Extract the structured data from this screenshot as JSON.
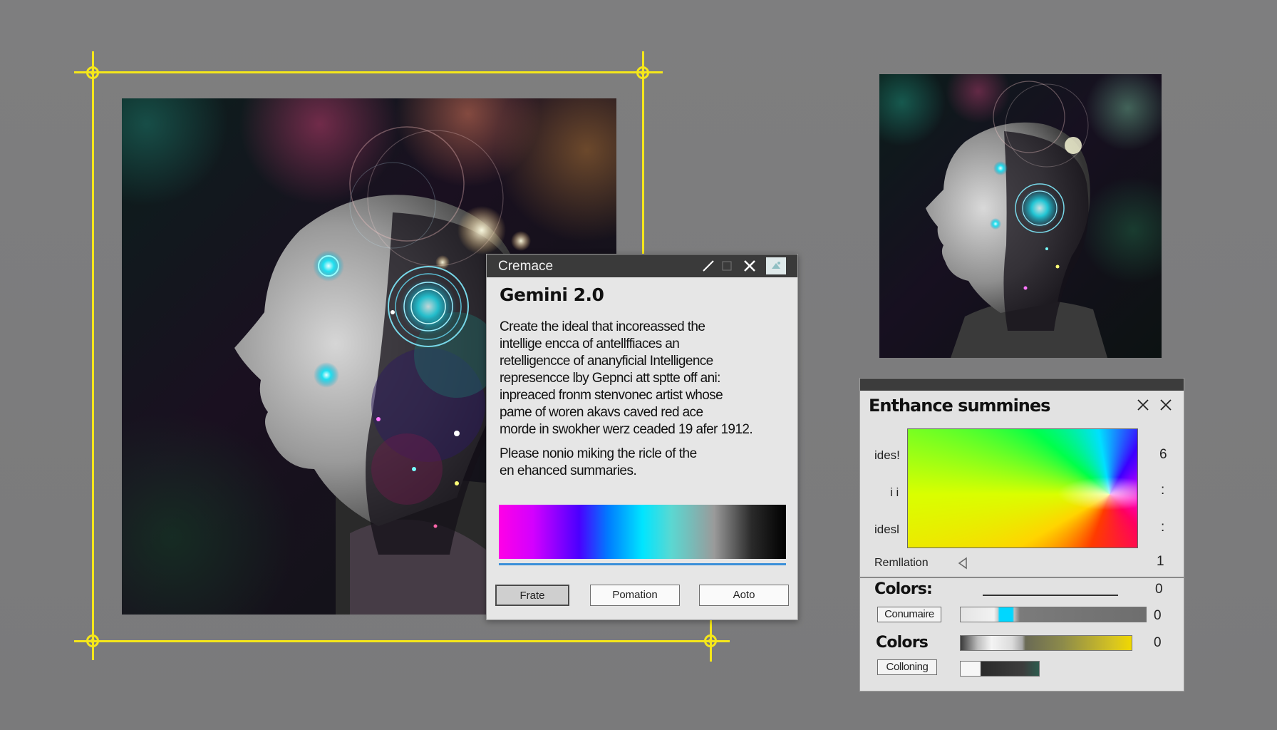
{
  "dialog": {
    "title": "Cremace",
    "heading": "Gemini 2.0",
    "body_lines": [
      "Create the ideal that incoreassed the",
      "intellige encca of antellffiaces an",
      "retelligencce of ananyficial Intelligence",
      "represencce lby Gepnci att sptte  off ani:",
      "inpreaced fronm stenvonec artist whose",
      "pame of woren akavs caved red ace",
      "morde in swokher werz ceaded 19 afer 1912."
    ],
    "prompt_lines": [
      "Please nonio miking the ricle of the",
      "en ehanced summaries."
    ],
    "buttons": {
      "primary": "Frate",
      "secondary": "Pomation",
      "tertiary": "Aoto"
    }
  },
  "panel": {
    "title": "Enthance summines",
    "rows": [
      {
        "label": "ides!",
        "value": "6"
      },
      {
        "label": "i i",
        "value": ":"
      },
      {
        "label": "idesl",
        "value": ":"
      }
    ],
    "remlation": {
      "label": "Remllation",
      "value": "1"
    },
    "colors1": {
      "label": "Colors:",
      "value": "0"
    },
    "conumaire": {
      "label": "Conumaire",
      "value": "0"
    },
    "colors2": {
      "label": "Colors",
      "value": "0"
    },
    "colloning": {
      "label": "Colloning"
    }
  },
  "colors": {
    "crop_handles": "#f5e71a",
    "dialog_titlebar": "#3a3a3a",
    "accent_line": "#3b8fd9"
  },
  "icons": [
    "pen-icon",
    "square-icon",
    "close-icon",
    "image-icon",
    "close-icon",
    "close-icon",
    "triangle-left-icon"
  ]
}
